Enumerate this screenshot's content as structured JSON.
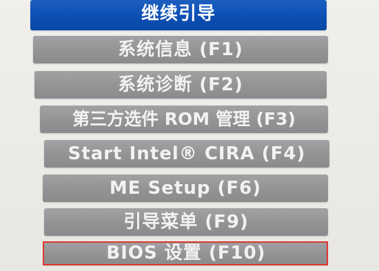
{
  "boot_menu": {
    "items": [
      {
        "label": "继续引导",
        "selected": true
      },
      {
        "label": "系统信息 (F1)",
        "selected": false
      },
      {
        "label": "系统诊断 (F2)",
        "selected": false
      },
      {
        "label": "第三方选件 ROM 管理 (F3)",
        "selected": false
      },
      {
        "label": "Start Intel® CIRA (F4)",
        "selected": false
      },
      {
        "label": "ME Setup (F6)",
        "selected": false
      },
      {
        "label": "引导菜单 (F9)",
        "selected": false
      },
      {
        "label": "BIOS 设置 (F10)",
        "selected": false
      }
    ]
  },
  "annotation": {
    "highlighted_item": "BIOS 设置 (F10)",
    "color": "#e0332e"
  },
  "colors": {
    "selected_item": "#0b4fb3",
    "item": "#939395",
    "text": "#f2f2f2",
    "background": "#ecebe8"
  }
}
